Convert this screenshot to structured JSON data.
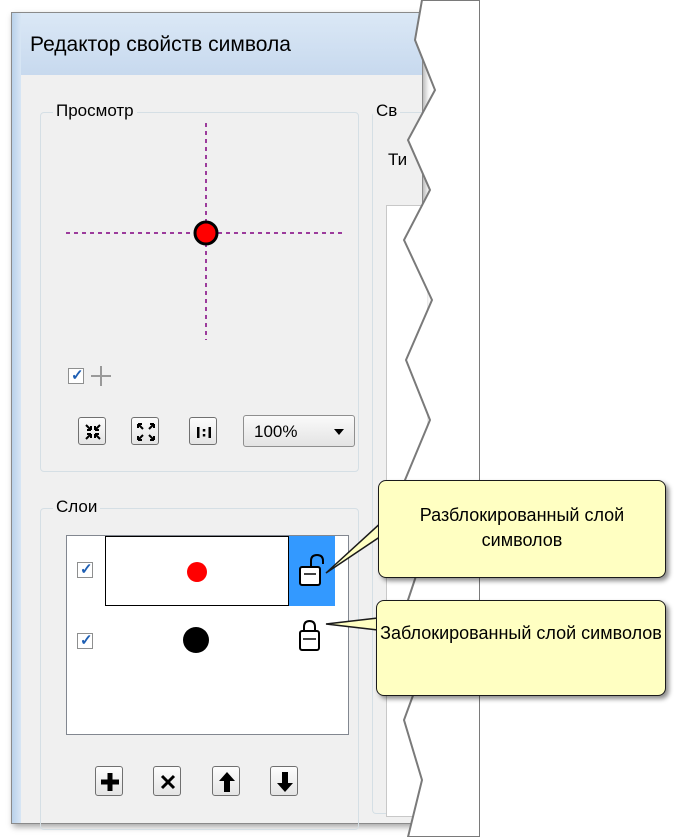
{
  "window": {
    "title": "Редактор свойств символа"
  },
  "preview": {
    "legend": "Просмотр",
    "point_color": "#ff0000",
    "crosshair_color": "#800080",
    "show_crosshair_checked": true,
    "zoom_value": "100%"
  },
  "properties": {
    "legend_partial": "Св",
    "type_partial": "Ти"
  },
  "layers": {
    "legend": "Слои",
    "items": [
      {
        "visible": true,
        "symbol_color": "#ff0000",
        "locked": false,
        "selected": true
      },
      {
        "visible": true,
        "symbol_color": "#000000",
        "locked": true,
        "selected": false
      }
    ],
    "selection_color": "#3399ff"
  },
  "callouts": {
    "unlocked": "Разблокированный слой символов",
    "locked": "Заблокированный слой символов"
  },
  "icons": {
    "zoom_in": "collapse-arrows-icon",
    "zoom_out": "expand-arrows-icon",
    "actual_size": "one-to-one-icon",
    "add_layer": "plus-icon",
    "delete_layer": "x-icon",
    "move_up": "arrow-up-icon",
    "move_down": "arrow-down-icon",
    "add_point": "crosshair-plus-icon"
  }
}
